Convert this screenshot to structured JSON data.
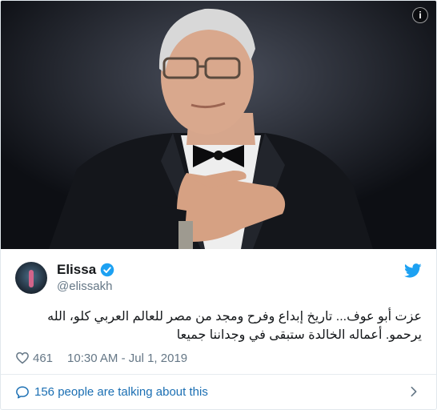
{
  "media": {
    "info_glyph": "i"
  },
  "author": {
    "name": "Elissa",
    "handle": "@elissakh",
    "verified": true
  },
  "tweet": {
    "text": "عزت أبو عوف... تاريخ إبداع وفرح ومجد من مصر للعالم العربي كلو، الله يرحمو. أعماله الخالدة ستبقى في وجداننا جميعا"
  },
  "meta": {
    "likes": "461",
    "timestamp": "10:30 AM - Jul 1, 2019"
  },
  "footer": {
    "talking": "156 people are talking about this"
  },
  "colors": {
    "twitter_blue": "#1da1f2",
    "link_blue": "#1b6fb3",
    "muted": "#657786"
  },
  "icons": {
    "info": "info-icon",
    "verified": "verified-badge-icon",
    "bird": "twitter-bird-icon",
    "heart": "heart-icon",
    "bubble": "speech-bubble-icon",
    "chevron": "chevron-right-icon"
  }
}
